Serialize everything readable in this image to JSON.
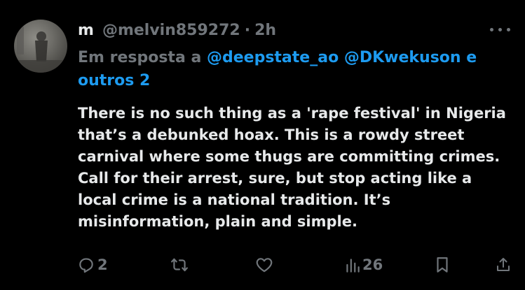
{
  "author": {
    "display_name": "m",
    "handle": "@melvin859272",
    "separator": "·",
    "time": "2h"
  },
  "reply_context": {
    "prefix": "Em resposta a",
    "mention_1": "@deepstate_ao",
    "mention_2": "@DKwekuson",
    "suffix": "e outros 2"
  },
  "post": {
    "text": "There is no such thing as a 'rape festival' in Nigeria that’s a debunked hoax. This is a rowdy street carnival where some thugs are committing crimes. Call for their arrest, sure, but stop acting like a local crime is a national tradition. It’s misinformation, plain and simple."
  },
  "actions": {
    "replies": "2",
    "views": "26"
  },
  "icons": {
    "more": "more-horizontal-icon",
    "reply": "reply-icon",
    "repost": "repost-icon",
    "like": "heart-icon",
    "views": "analytics-icon",
    "bookmark": "bookmark-icon",
    "share": "share-icon"
  },
  "colors": {
    "background": "#000000",
    "text": "#e7e9ea",
    "secondary": "#71767b",
    "link": "#1d9bf0"
  }
}
